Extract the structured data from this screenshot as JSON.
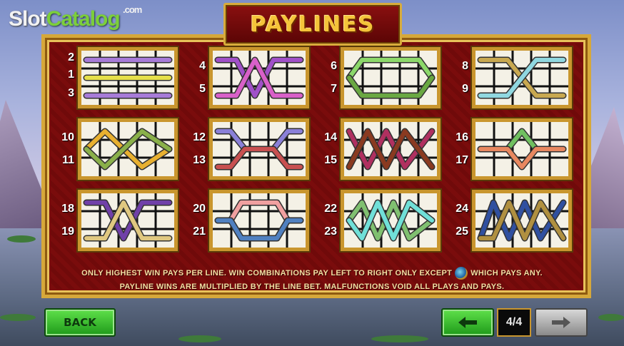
{
  "logo": {
    "part1": "Slot",
    "part2": "Catalog",
    "suffix": ".com"
  },
  "title": "PAYLINES",
  "paylines": [
    {
      "nums_top": "2",
      "nums_mid": "1",
      "nums_bot": "3",
      "colors": [
        "#a77bd8",
        "#e6e04a",
        "#a77bd8"
      ]
    },
    {
      "nums_top": "4",
      "nums_bot": "5",
      "colors": [
        "#a050c8",
        "#d860c8"
      ]
    },
    {
      "nums_top": "6",
      "nums_bot": "7",
      "colors": [
        "#8cd86a",
        "#6aa842"
      ]
    },
    {
      "nums_top": "8",
      "nums_bot": "9",
      "colors": [
        "#c8a850",
        "#90d8e0"
      ]
    },
    {
      "nums_top": "10",
      "nums_bot": "11",
      "colors": [
        "#e8b030",
        "#8ab04a"
      ]
    },
    {
      "nums_top": "12",
      "nums_bot": "13",
      "colors": [
        "#8a80d8",
        "#c85050"
      ]
    },
    {
      "nums_top": "14",
      "nums_bot": "15",
      "colors": [
        "#b03060",
        "#8a3a20"
      ]
    },
    {
      "nums_top": "16",
      "nums_bot": "17",
      "colors": [
        "#70c060",
        "#e88860"
      ]
    },
    {
      "nums_top": "18",
      "nums_bot": "19",
      "colors": [
        "#7040a8",
        "#e0c880"
      ]
    },
    {
      "nums_top": "20",
      "nums_bot": "21",
      "colors": [
        "#f0a0a0",
        "#5080c0"
      ]
    },
    {
      "nums_top": "22",
      "nums_bot": "23",
      "colors": [
        "#80c070",
        "#70e0d8"
      ]
    },
    {
      "nums_top": "24",
      "nums_bot": "25",
      "colors": [
        "#3050a0",
        "#b09040"
      ]
    }
  ],
  "footer": {
    "line1_a": "ONLY HIGHEST WIN PAYS PER LINE. WIN COMBINATIONS PAY LEFT TO RIGHT ONLY EXCEPT",
    "line1_b": "WHICH PAYS ANY.",
    "line2": "PAYLINE WINS ARE MULTIPLIED BY THE LINE BET. MALFUNCTIONS VOID ALL PLAYS AND PAYS."
  },
  "buttons": {
    "back": "BACK",
    "prev_icon": "arrow-left-icon",
    "next_icon": "arrow-right-icon"
  },
  "page": "4/4"
}
